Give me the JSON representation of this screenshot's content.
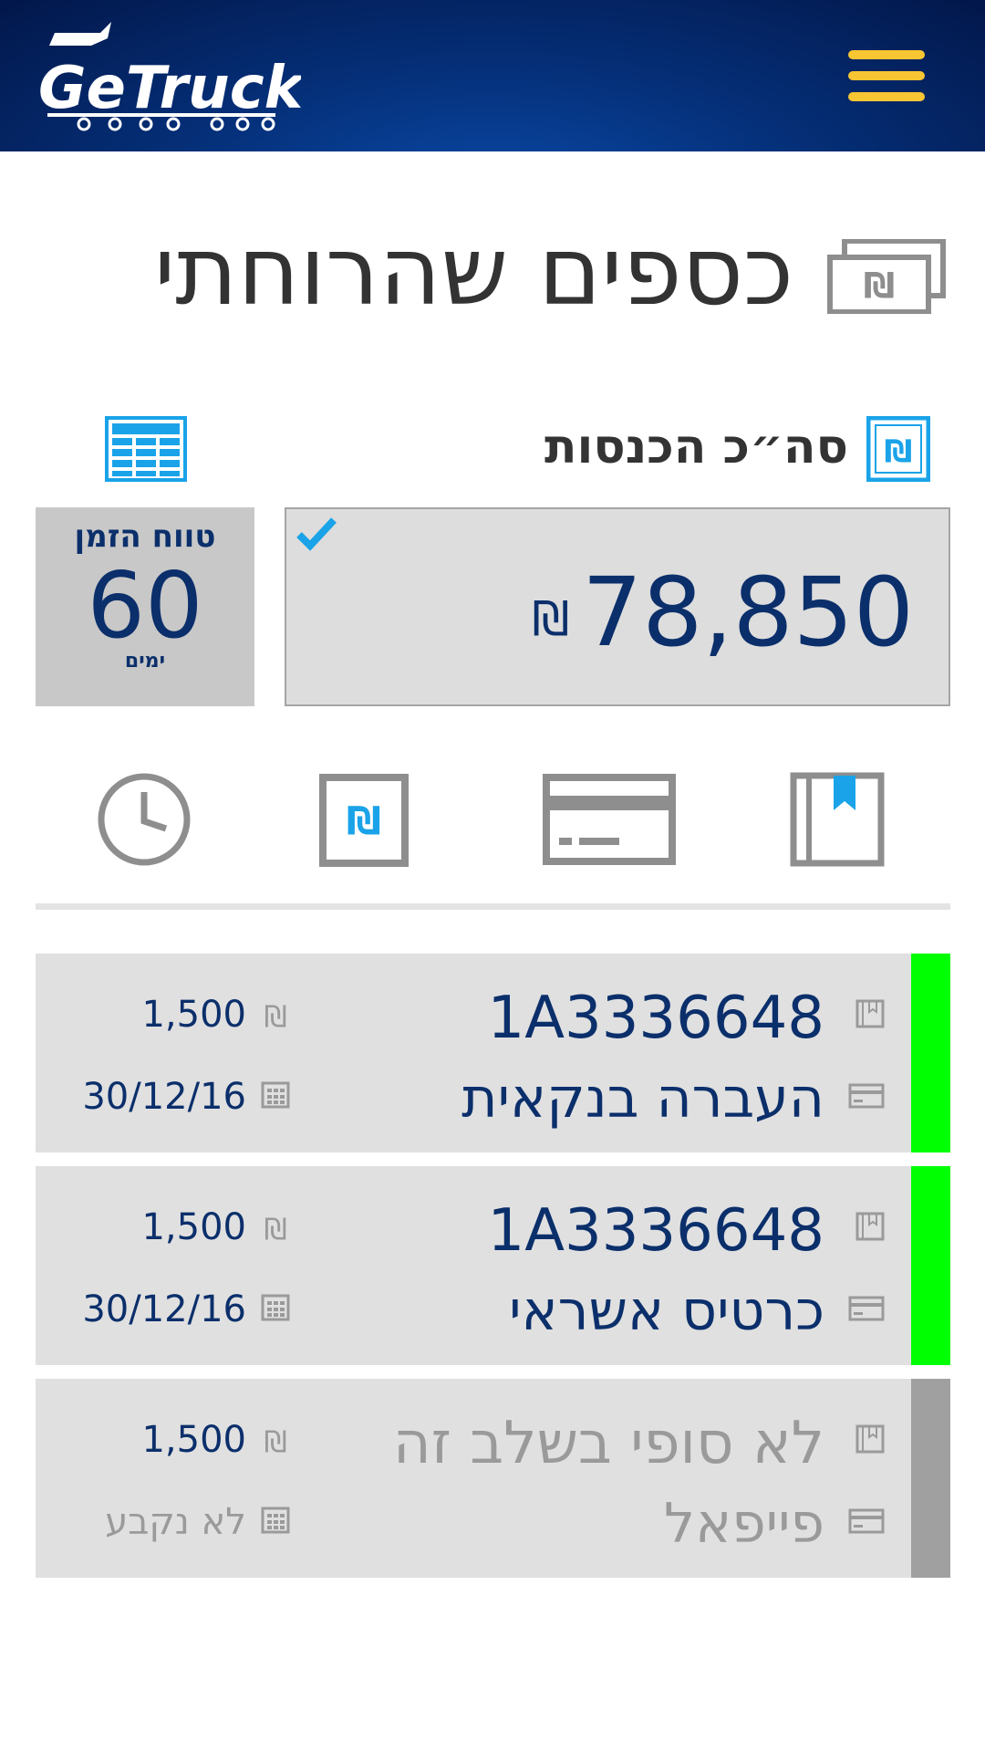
{
  "header": {
    "logo_text": "GeTruck",
    "menu_icon": "hamburger-menu-icon",
    "accent_color": "#f7c632"
  },
  "page": {
    "title": "כספים שהרוחתי",
    "title_icon": "money-bills-icon"
  },
  "summary": {
    "label": "סה״כ הכנסות",
    "label_icon": "shekel-icon",
    "table_icon": "table-view-icon",
    "total_amount": "78,850",
    "currency_symbol": "₪",
    "selected_icon": "checkmark-icon",
    "range_label": "טווח הזמן",
    "range_value": "60",
    "range_unit": "ימים"
  },
  "filters": [
    {
      "name": "clock-icon"
    },
    {
      "name": "shekel-icon"
    },
    {
      "name": "credit-card-icon"
    },
    {
      "name": "bookmark-book-icon"
    }
  ],
  "payments": [
    {
      "reference": "1A3336648",
      "method": "העברה בנקאית",
      "amount": "1,500",
      "date": "30/12/16",
      "status_color": "#00ff00"
    },
    {
      "reference": "1A3336648",
      "method": "כרטיס אשראי",
      "amount": "1,500",
      "date": "30/12/16",
      "status_color": "#00ff00"
    },
    {
      "reference": "לא סופי בשלב זה",
      "method": "פייפאל",
      "amount": "1,500",
      "date": "לא נקבע",
      "status_color": "#a0a0a0"
    }
  ],
  "colors": {
    "primary_text": "#0b2f6b",
    "icon_blue": "#1aa3e8",
    "icon_gray": "#8e8e8e"
  }
}
